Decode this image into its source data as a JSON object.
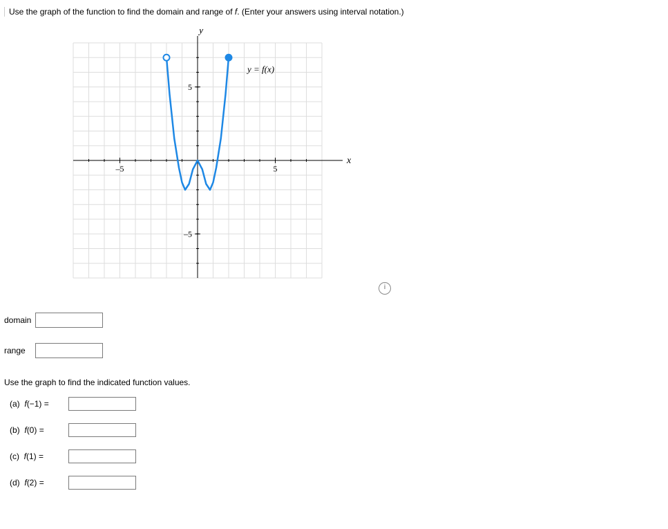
{
  "prompt": {
    "pre": "Use the graph of the function to find the domain and range of ",
    "fnname": "f",
    "post": ". (Enter your answers using interval notation.)"
  },
  "fields": {
    "domain_label": "domain",
    "range_label": "range"
  },
  "subprompt": "Use the graph to find the indicated function values.",
  "parts": {
    "a": {
      "letter": "(a)",
      "expr_pre": "f",
      "expr_arg": "(−1) ="
    },
    "b": {
      "letter": "(b)",
      "expr_pre": "f",
      "expr_arg": "(0) ="
    },
    "c": {
      "letter": "(c)",
      "expr_pre": "f",
      "expr_arg": "(1) ="
    },
    "d": {
      "letter": "(d)",
      "expr_pre": "f",
      "expr_arg": "(2) ="
    }
  },
  "chart_data": {
    "type": "line",
    "xlabel": "x",
    "ylabel": "y",
    "curve_label": "y = f(x)",
    "xlim": [
      -8,
      8
    ],
    "ylim": [
      -8,
      8
    ],
    "x_ticks": [
      -5,
      5
    ],
    "y_ticks": [
      -5,
      5
    ],
    "open_point": {
      "x": -2,
      "y": 7
    },
    "closed_point": {
      "x": 2,
      "y": 7
    },
    "series": [
      {
        "x": -2.0,
        "y": 7.0
      },
      {
        "x": -1.8,
        "y": 4.5
      },
      {
        "x": -1.5,
        "y": 1.5
      },
      {
        "x": -1.2,
        "y": -0.5
      },
      {
        "x": -1.0,
        "y": -1.5
      },
      {
        "x": -0.8,
        "y": -2.0
      },
      {
        "x": -0.55,
        "y": -1.6
      },
      {
        "x": -0.3,
        "y": -0.6
      },
      {
        "x": 0.0,
        "y": 0.0
      },
      {
        "x": 0.3,
        "y": -0.6
      },
      {
        "x": 0.55,
        "y": -1.6
      },
      {
        "x": 0.8,
        "y": -2.0
      },
      {
        "x": 1.0,
        "y": -1.5
      },
      {
        "x": 1.2,
        "y": -0.5
      },
      {
        "x": 1.5,
        "y": 1.5
      },
      {
        "x": 1.8,
        "y": 4.5
      },
      {
        "x": 2.0,
        "y": 7.0
      }
    ]
  },
  "info_icon_glyph": "i"
}
